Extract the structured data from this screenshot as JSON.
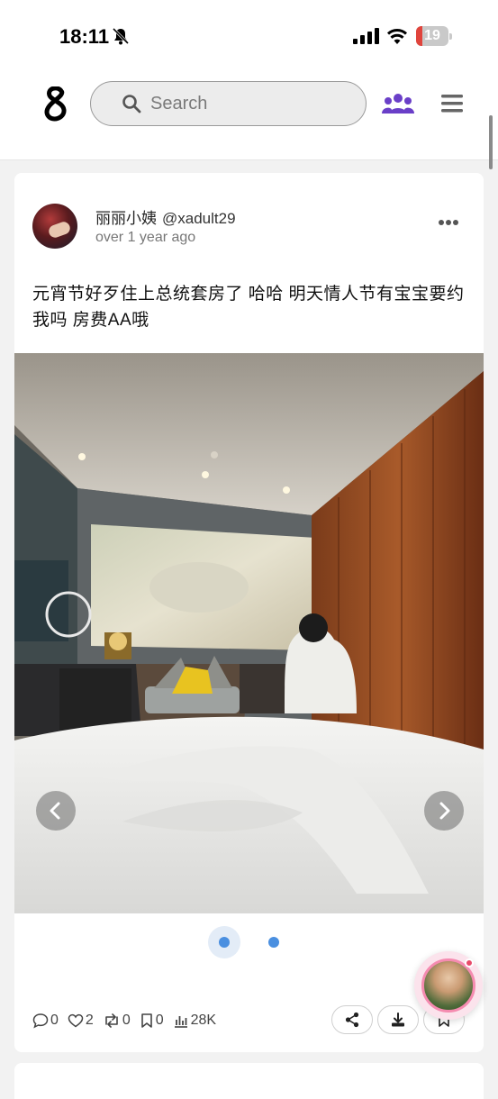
{
  "status_bar": {
    "time": "18:11",
    "battery": "19",
    "battery_level": 0.19,
    "icons": [
      "bell-off-icon",
      "signal-icon",
      "wifi-icon",
      "battery-icon"
    ]
  },
  "header": {
    "logo_icon": "s-logo-icon",
    "search_placeholder": "Search",
    "people_icon": "people-icon",
    "menu_icon": "hamburger-menu-icon",
    "accent_color": "#6a3fc8"
  },
  "post": {
    "user_name": "丽丽小姨",
    "handle": "@xadult29",
    "time": "over 1 year ago",
    "text": "元宵节好歹住上总统套房了 哈哈 明天情人节有宝宝要约我吗 房费AA哦",
    "carousel": {
      "current": 1,
      "total": 2
    },
    "stats": {
      "comments": "0",
      "likes": "2",
      "reposts": "0",
      "bookmarks": "0",
      "views": "28K"
    },
    "actions": [
      "share-icon",
      "download-icon",
      "bookmark-icon"
    ]
  },
  "colors": {
    "dot": "#4a8fe0",
    "background": "#f2f2f2"
  }
}
